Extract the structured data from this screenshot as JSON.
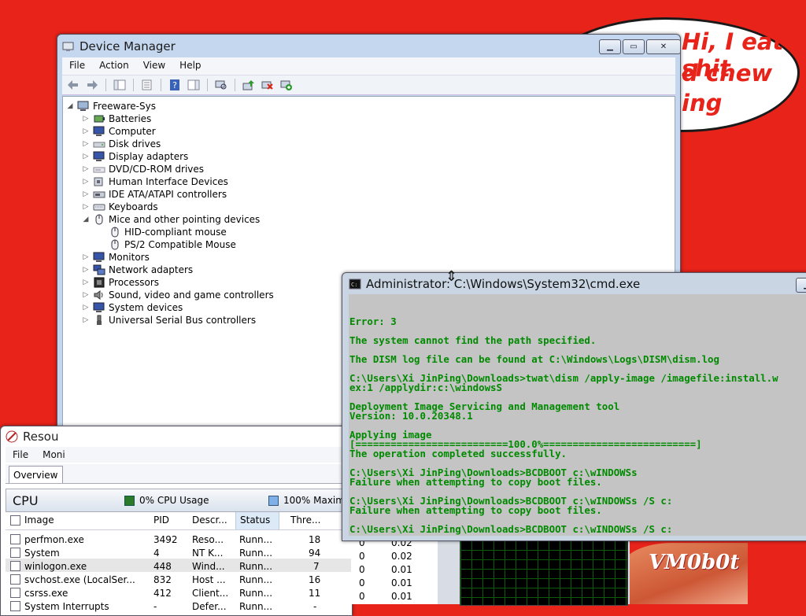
{
  "wallpaper": {
    "bubble_line1": "Hi, I eat shit",
    "bubble_line2": "d chew",
    "bubble_line3": "ing",
    "signature": "VM0b0t",
    "background_color": "#e8231a"
  },
  "device_manager": {
    "title": "Device Manager",
    "menu": [
      "File",
      "Action",
      "View",
      "Help"
    ],
    "toolbar_icons": [
      "back-icon",
      "forward-icon",
      "console-tree-icon",
      "properties-icon",
      "help-icon",
      "action-pane-icon",
      "scan-hardware-icon",
      "update-driver-icon",
      "uninstall-icon",
      "enable-device-icon"
    ],
    "root": "Freeware-Sys",
    "items": [
      {
        "label": "Batteries",
        "expanded": false
      },
      {
        "label": "Computer",
        "expanded": false
      },
      {
        "label": "Disk drives",
        "expanded": false
      },
      {
        "label": "Display adapters",
        "expanded": false
      },
      {
        "label": "DVD/CD-ROM drives",
        "expanded": false
      },
      {
        "label": "Human Interface Devices",
        "expanded": false
      },
      {
        "label": "IDE ATA/ATAPI controllers",
        "expanded": false
      },
      {
        "label": "Keyboards",
        "expanded": false
      },
      {
        "label": "Mice and other pointing devices",
        "expanded": true
      },
      {
        "label": "HID-compliant mouse",
        "child": true
      },
      {
        "label": "PS/2 Compatible Mouse",
        "child": true
      },
      {
        "label": "Monitors",
        "expanded": false
      },
      {
        "label": "Network adapters",
        "expanded": false
      },
      {
        "label": "Processors",
        "expanded": false
      },
      {
        "label": "Sound, video and game controllers",
        "expanded": false
      },
      {
        "label": "System devices",
        "expanded": false
      },
      {
        "label": "Universal Serial Bus controllers",
        "expanded": false
      }
    ]
  },
  "resource_monitor": {
    "title": "Resou",
    "menu": [
      "File",
      "Moni"
    ],
    "tab": "Overview",
    "cpu_title": "CPU",
    "cpu_usage": "0% CPU Usage",
    "cpu_max": "100% Maxim",
    "columns": [
      "Image",
      "PID",
      "Descr...",
      "Status",
      "Thre..."
    ],
    "rows": [
      {
        "image": "perfmon.exe",
        "pid": "3492",
        "desc": "Reso...",
        "status": "Runn...",
        "threads": "18",
        "cycle": "0",
        "avg": "0.02"
      },
      {
        "image": "System",
        "pid": "4",
        "desc": "NT K...",
        "status": "Runn...",
        "threads": "94",
        "cycle": "0",
        "avg": "0.02"
      },
      {
        "image": "winlogon.exe",
        "pid": "448",
        "desc": "Wind...",
        "status": "Runn...",
        "threads": "7",
        "cycle": "0",
        "avg": "0.01"
      },
      {
        "image": "svchost.exe (LocalSer...",
        "pid": "832",
        "desc": "Host ...",
        "status": "Runn...",
        "threads": "16",
        "cycle": "0",
        "avg": "0.01"
      },
      {
        "image": "csrss.exe",
        "pid": "412",
        "desc": "Client...",
        "status": "Runn...",
        "threads": "11",
        "cycle": "0",
        "avg": "0.01"
      },
      {
        "image": "System Interrupts",
        "pid": "-",
        "desc": "Defer...",
        "status": "Runn...",
        "threads": "-",
        "cycle": "0",
        "avg": "0.01"
      }
    ]
  },
  "cmd": {
    "title": "Administrator: C:\\Windows\\System32\\cmd.exe",
    "lines": [
      "Error: 3",
      "",
      "The system cannot find the path specified.",
      "",
      "The DISM log file can be found at C:\\Windows\\Logs\\DISM\\dism.log",
      "",
      "C:\\Users\\Xi JinPing\\Downloads>twat\\dism /apply-image /imagefile:install.w",
      "ex:1 /applydir:c:\\windowsS",
      "",
      "Deployment Image Servicing and Management tool",
      "Version: 10.0.20348.1",
      "",
      "Applying image",
      "[==========================100.0%==========================]",
      "The operation completed successfully.",
      "",
      "C:\\Users\\Xi JinPing\\Downloads>BCDBOOT c:\\wINDOWSs",
      "Failure when attempting to copy boot files.",
      "",
      "C:\\Users\\Xi JinPing\\Downloads>BCDBOOT c:\\wINDOWSs /S c:",
      "Failure when attempting to copy boot files.",
      "",
      "C:\\Users\\Xi JinPing\\Downloads>BCDBOOT c:\\wINDOWSs /S c:"
    ],
    "text_color": "#008a00",
    "background_color": "#c4c4c4"
  }
}
